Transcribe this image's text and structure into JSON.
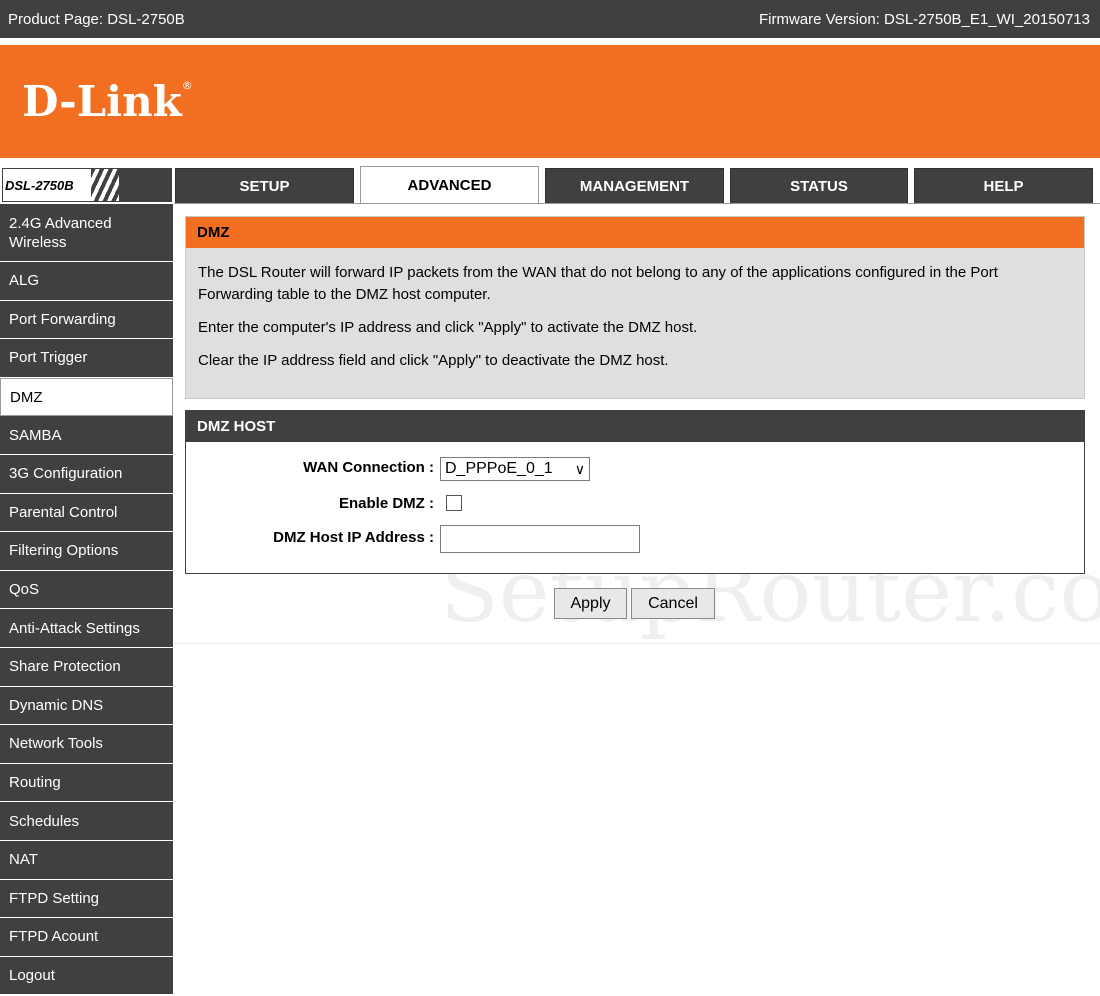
{
  "header": {
    "product_page": "Product Page: DSL-2750B",
    "firmware": "Firmware Version: DSL-2750B_E1_WI_20150713"
  },
  "brand": {
    "logo_text": "D-Link",
    "logo_mark": "®",
    "accent_color": "#f26f21",
    "dark_color": "#404040"
  },
  "nav": {
    "model": "DSL-2750B",
    "tabs": [
      {
        "label": "SETUP"
      },
      {
        "label": "ADVANCED"
      },
      {
        "label": "MANAGEMENT"
      },
      {
        "label": "STATUS"
      },
      {
        "label": "HELP"
      }
    ],
    "active_tab": "ADVANCED"
  },
  "sidebar": {
    "items": [
      {
        "label": "2.4G Advanced Wireless"
      },
      {
        "label": "ALG"
      },
      {
        "label": "Port Forwarding"
      },
      {
        "label": "Port Trigger"
      },
      {
        "label": "DMZ"
      },
      {
        "label": "SAMBA"
      },
      {
        "label": "3G Configuration"
      },
      {
        "label": "Parental Control"
      },
      {
        "label": "Filtering Options"
      },
      {
        "label": "QoS"
      },
      {
        "label": "Anti-Attack Settings"
      },
      {
        "label": "Share Protection"
      },
      {
        "label": "Dynamic DNS"
      },
      {
        "label": "Network Tools"
      },
      {
        "label": "Routing"
      },
      {
        "label": "Schedules"
      },
      {
        "label": "NAT"
      },
      {
        "label": "FTPD Setting"
      },
      {
        "label": "FTPD Acount"
      },
      {
        "label": "Logout"
      }
    ],
    "active_item": "DMZ"
  },
  "dmz_panel": {
    "title": "DMZ",
    "paragraphs": [
      "The DSL Router will forward IP packets from the WAN that do not belong to any of the applications configured in the Port Forwarding table to the DMZ host computer.",
      "Enter the computer's IP address and click \"Apply\" to activate the DMZ host.",
      "Clear the IP address field and click \"Apply\" to deactivate the DMZ host."
    ]
  },
  "host_panel": {
    "title": "DMZ HOST",
    "wan_connection_label": "WAN Connection :",
    "wan_connection_value": "D_PPPoE_0_1",
    "enable_dmz_label": "Enable DMZ :",
    "enable_dmz_checked": false,
    "host_ip_label": "DMZ Host IP Address :",
    "host_ip_value": ""
  },
  "actions": {
    "apply_label": "Apply",
    "cancel_label": "Cancel"
  },
  "watermark": "SetupRouter.co"
}
